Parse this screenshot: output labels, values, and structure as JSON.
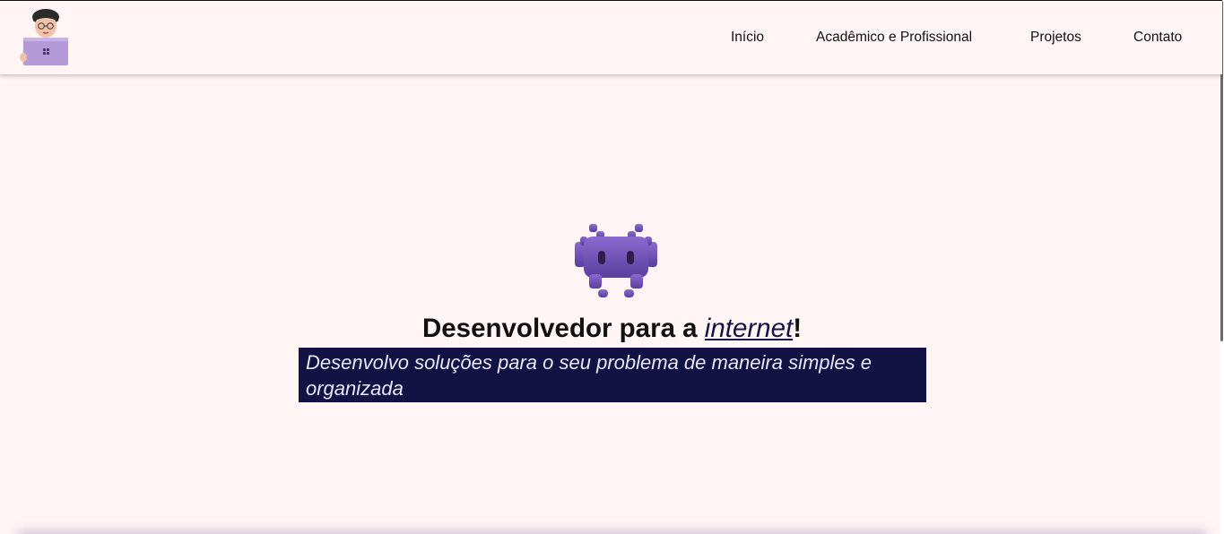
{
  "header": {
    "logo_icon": "developer-avatar-icon",
    "nav": [
      {
        "label": "Início"
      },
      {
        "label": "Acadêmico e Profissional"
      },
      {
        "label": "Projetos"
      },
      {
        "label": "Contato"
      }
    ]
  },
  "hero": {
    "icon": "alien-monster-icon",
    "title_before": "Desenvolvedor para a ",
    "title_highlight": "internet",
    "title_after": "!",
    "subtitle": "Desenvolvo soluções para o seu problema de maneira simples e organizada"
  },
  "colors": {
    "background": "#fff5f4",
    "accent": "#131245",
    "invader": "#6a4fb5"
  }
}
